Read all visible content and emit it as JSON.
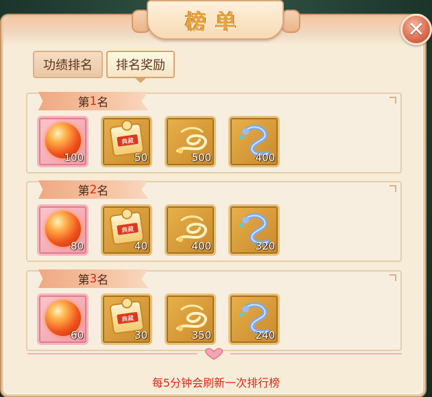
{
  "title": "榜单",
  "close_icon": "close-icon",
  "tabs": [
    {
      "label": "功绩排名",
      "selected": false
    },
    {
      "label": "排名奖励",
      "selected": true
    }
  ],
  "ranks": [
    {
      "prefix": "第",
      "number": "1",
      "suffix": "名",
      "rewards": [
        {
          "icon": "fire-orb-icon",
          "qty": "100"
        },
        {
          "icon": "puzzle-piece-icon",
          "qty": "50",
          "tag": "典藏"
        },
        {
          "icon": "golden-swirl-icon",
          "qty": "500"
        },
        {
          "icon": "blue-dragon-icon",
          "qty": "400"
        }
      ]
    },
    {
      "prefix": "第",
      "number": "2",
      "suffix": "名",
      "rewards": [
        {
          "icon": "fire-orb-icon",
          "qty": "80"
        },
        {
          "icon": "puzzle-piece-icon",
          "qty": "40",
          "tag": "典藏"
        },
        {
          "icon": "golden-swirl-icon",
          "qty": "400"
        },
        {
          "icon": "blue-dragon-icon",
          "qty": "320"
        }
      ]
    },
    {
      "prefix": "第",
      "number": "3",
      "suffix": "名",
      "rewards": [
        {
          "icon": "fire-orb-icon",
          "qty": "60"
        },
        {
          "icon": "puzzle-piece-icon",
          "qty": "30",
          "tag": "典藏"
        },
        {
          "icon": "golden-swirl-icon",
          "qty": "350"
        },
        {
          "icon": "blue-dragon-icon",
          "qty": "240"
        }
      ]
    }
  ],
  "footer": "每5分钟会刷新一次排行榜",
  "colors": {
    "accent_red": "#d8281c",
    "panel_bg": "#f6ecd8",
    "gold_frame": "#e7c27a"
  }
}
